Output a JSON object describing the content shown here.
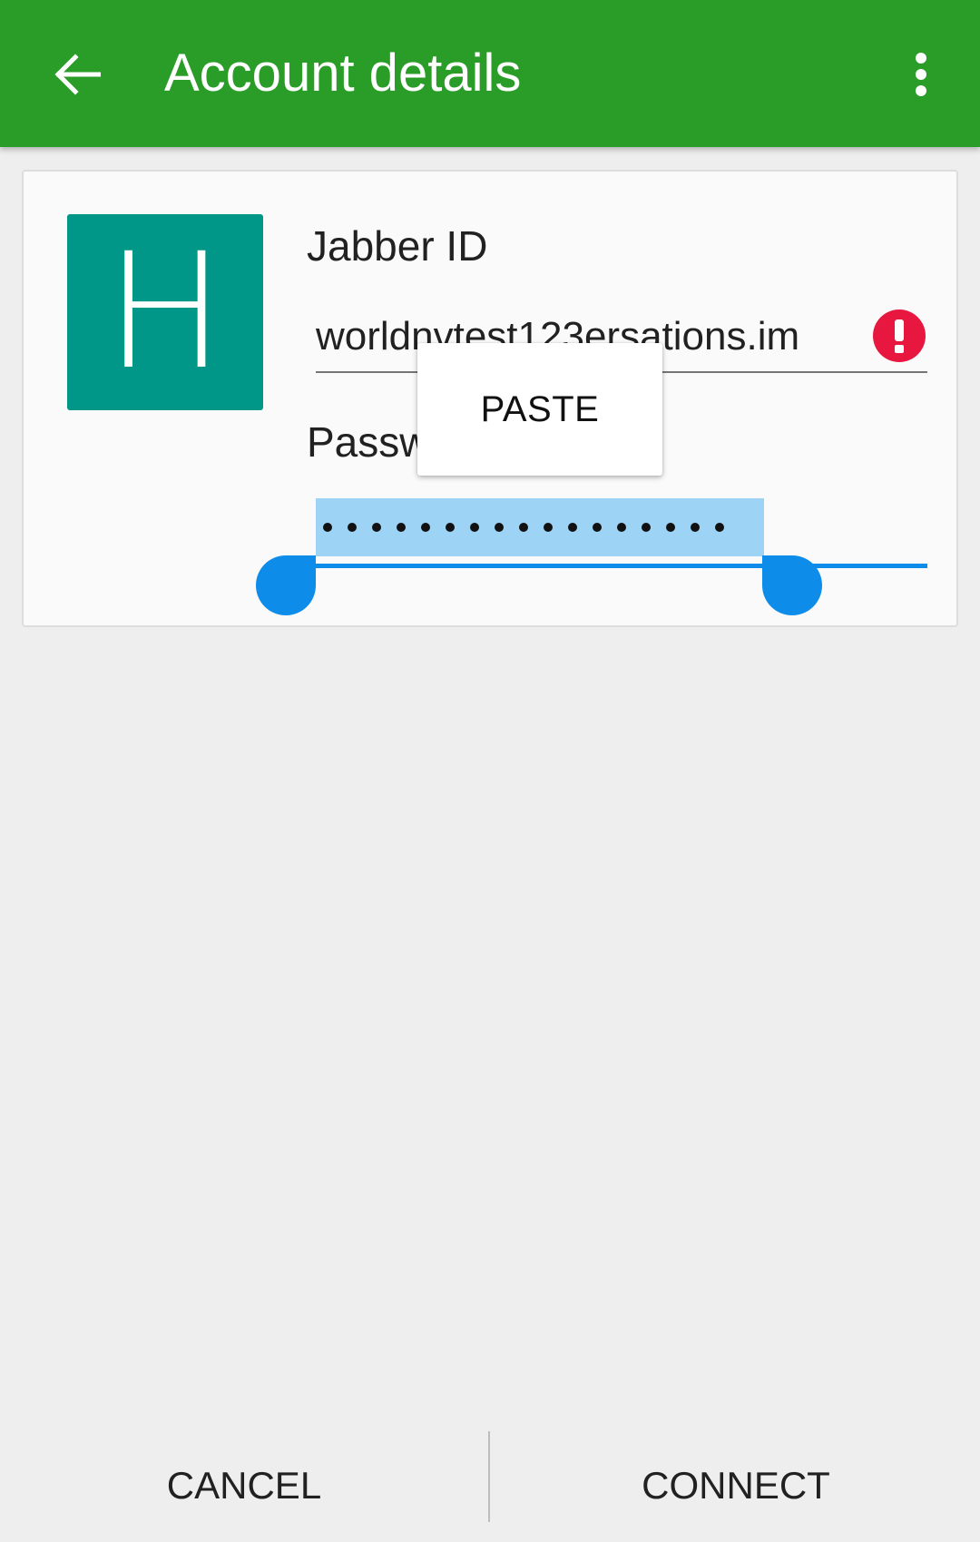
{
  "app_bar": {
    "title": "Account details",
    "background_color": "#2a9d28",
    "back_icon": "arrow-back-icon",
    "menu_icon": "more-vert-icon"
  },
  "account": {
    "avatar_letter": "H",
    "avatar_color": "#009688",
    "jabber_id": {
      "label": "Jabber ID",
      "value": "worldnvtest123ersations.im",
      "error_icon": "error-icon",
      "error_color": "#e8173f"
    },
    "password": {
      "label": "Passw",
      "masked_value": "•••••••••••••••••",
      "selected": true,
      "selection_color": "#9dd3f5"
    }
  },
  "context_popup": {
    "paste_label": "PASTE"
  },
  "footer": {
    "cancel_label": "CANCEL",
    "connect_label": "CONNECT"
  }
}
